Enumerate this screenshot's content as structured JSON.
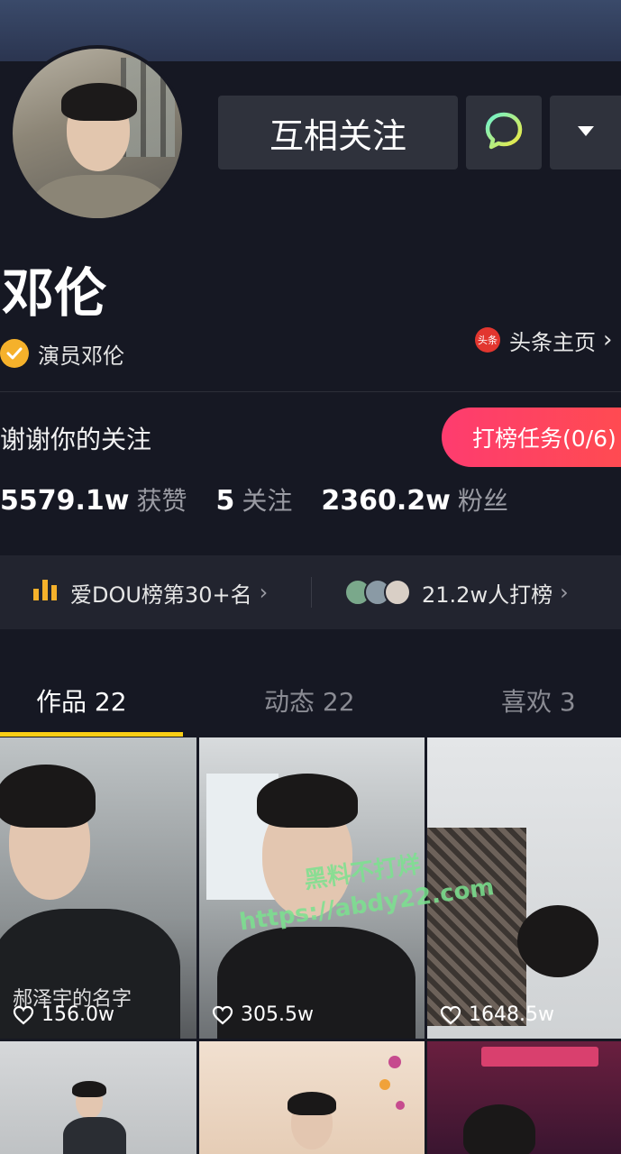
{
  "profile": {
    "name": "邓伦",
    "verification": "演员邓伦",
    "toutiao_icon": "头条",
    "toutiao_label": "头条主页",
    "bio": "谢谢你的关注",
    "rank_task": "打榜任务(0/6)"
  },
  "actions": {
    "follow_label": "互相关注",
    "chat_icon": "chat-bubble-icon",
    "more_icon": "dropdown-arrow-icon"
  },
  "stats": {
    "likes_count": "5579.1w",
    "likes_label": "获赞",
    "following_count": "5",
    "following_label": "关注",
    "followers_count": "2360.2w",
    "followers_label": "粉丝"
  },
  "dou": {
    "rank_text": "爱DOU榜第30+名",
    "supporters_text": "21.2w人打榜"
  },
  "tabs": [
    {
      "label": "作品 22",
      "active": true
    },
    {
      "label": "动态 22",
      "active": false
    },
    {
      "label": "喜欢 3",
      "active": false
    }
  ],
  "videos": [
    {
      "likes": "156.0w",
      "caption": "郝泽宇的名字"
    },
    {
      "likes": "305.5w"
    },
    {
      "likes": "1648.5w"
    }
  ],
  "watermark": {
    "line1": "黑料不打烊",
    "line2": "https://abdy22.com"
  },
  "colors": {
    "background": "#161823",
    "accent_yellow": "#face15",
    "rank_task_gradient_start": "#fe3c6f",
    "rank_task_gradient_end": "#ff4d4d"
  }
}
